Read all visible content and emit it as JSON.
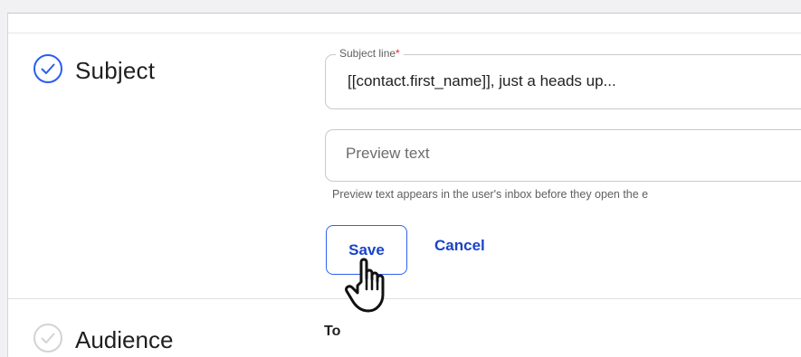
{
  "subject_section": {
    "title": "Subject",
    "icon": "check-circle-icon",
    "subject_field": {
      "label": "Subject line",
      "required_mark": "*",
      "value": "[[contact.first_name]], just a heads up..."
    },
    "preview_field": {
      "placeholder": "Preview text",
      "value": ""
    },
    "helper_text": "Preview text appears in the user's inbox before they open the e",
    "save_label": "Save",
    "cancel_label": "Cancel"
  },
  "audience_section": {
    "title": "Audience",
    "icon": "check-circle-icon",
    "to_label": "To"
  },
  "cursor": "hand-pointer-icon",
  "colors": {
    "accent": "#2f5ff2",
    "link": "#1a44c8",
    "required": "#e0243a",
    "check_icon": "#2a5df0"
  }
}
